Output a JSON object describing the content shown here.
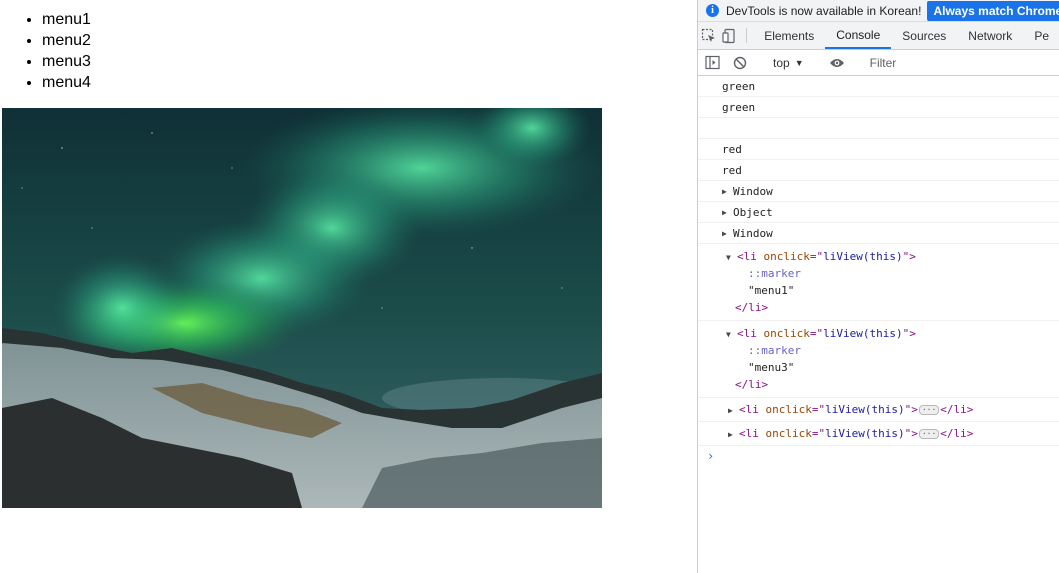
{
  "page": {
    "menu": [
      "menu1",
      "menu2",
      "menu3",
      "menu4"
    ],
    "image_alt": "aurora landscape"
  },
  "devtools": {
    "infobar": {
      "icon": "i",
      "text": "DevTools is now available in Korean!",
      "button": "Always match Chrome's"
    },
    "tabs": [
      "Elements",
      "Console",
      "Sources",
      "Network",
      "Pe"
    ],
    "active_tab": "Console",
    "toolbar": {
      "context": "top",
      "context_arrow": "▼",
      "filter_placeholder": "Filter"
    },
    "console": {
      "logs": [
        "green",
        "green",
        "",
        "red",
        "red"
      ],
      "objects": [
        "Window",
        "Object",
        "Window"
      ],
      "expanded_elements": [
        {
          "tag_open": "<li ",
          "attr": "onclick",
          "eq": "=\"",
          "value": "liView(this)",
          "tag_end": "\">",
          "marker": "::marker",
          "text": "\"menu1\"",
          "close": "</li>"
        },
        {
          "tag_open": "<li ",
          "attr": "onclick",
          "eq": "=\"",
          "value": "liView(this)",
          "tag_end": "\">",
          "marker": "::marker",
          "text": "\"menu3\"",
          "close": "</li>"
        }
      ],
      "collapsed_elements": [
        {
          "tag_open": "<li ",
          "attr": "onclick",
          "eq": "=\"",
          "value": "liView(this)",
          "tag_end": "\">",
          "ellipsis": "···",
          "close": "</li>"
        },
        {
          "tag_open": "<li ",
          "attr": "onclick",
          "eq": "=\"",
          "value": "liView(this)",
          "tag_end": "\">",
          "ellipsis": "···",
          "close": "</li>"
        }
      ],
      "prompt": "›"
    }
  },
  "colors": {
    "accent": "#1a73e8",
    "tag": "#881280",
    "attr": "#994500",
    "attr_value": "#1a1aa6",
    "pseudo": "#6a62c8"
  }
}
